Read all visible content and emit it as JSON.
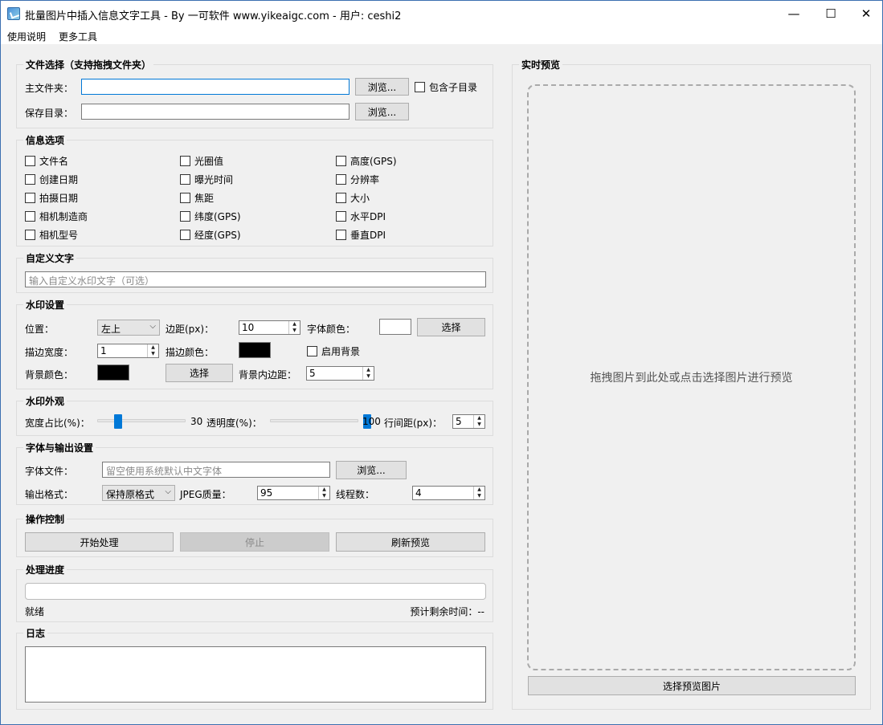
{
  "window": {
    "title": "批量图片中插入信息文字工具 - By 一可软件 www.yikeaigc.com - 用户: ceshi2",
    "minimize_glyph": "—",
    "maximize_glyph": "☐",
    "close_glyph": "✕"
  },
  "menu": [
    "使用说明",
    "更多工具"
  ],
  "file_select": {
    "title": "文件选择（支持拖拽文件夹）",
    "main_folder_label": "主文件夹：",
    "main_folder_value": "",
    "browse_label": "浏览...",
    "include_subdirs_label": "包含子目录",
    "save_dir_label": "保存目录：",
    "save_dir_value": "",
    "browse2_label": "浏览..."
  },
  "info_options": {
    "title": "信息选项",
    "items": [
      "文件名",
      "光圈值",
      "高度(GPS)",
      "创建日期",
      "曝光时间",
      "分辨率",
      "拍摄日期",
      "焦距",
      "大小",
      "相机制造商",
      "纬度(GPS)",
      "水平DPI",
      "相机型号",
      "经度(GPS)",
      "垂直DPI"
    ]
  },
  "custom_text": {
    "title": "自定义文字",
    "placeholder": "输入自定义水印文字（可选）"
  },
  "watermark": {
    "title": "水印设置",
    "position_label": "位置：",
    "position_value": "左上",
    "margin_label": "边距(px)：",
    "margin_value": "10",
    "font_color_label": "字体颜色：",
    "font_color": "#ffffff",
    "choose_label": "选择",
    "stroke_width_label": "描边宽度：",
    "stroke_width_value": "1",
    "stroke_color_label": "描边颜色：",
    "stroke_color": "#000000",
    "enable_bg_label": "启用背景",
    "bg_color_label": "背景颜色：",
    "bg_color": "#000000",
    "choose2_label": "选择",
    "bg_padding_label": "背景内边距：",
    "bg_padding_value": "5"
  },
  "appearance": {
    "title": "水印外观",
    "width_ratio_label": "宽度占比(%)：",
    "width_ratio_value": "30",
    "width_ratio_level": 30,
    "opacity_label": "透明度(%)：",
    "opacity_value": "100",
    "opacity_level": 100,
    "line_spacing_label": "行间距(px)：",
    "line_spacing_value": "5"
  },
  "font_output": {
    "title": "字体与输出设置",
    "font_file_label": "字体文件：",
    "font_file_placeholder": "留空使用系统默认中文字体",
    "browse_label": "浏览...",
    "output_format_label": "输出格式：",
    "output_format_value": "保持原格式",
    "jpeg_quality_label": "JPEG质量：",
    "jpeg_quality_value": "95",
    "threads_label": "线程数：",
    "threads_value": "4"
  },
  "controls": {
    "title": "操作控制",
    "start_label": "开始处理",
    "stop_label": "停止",
    "refresh_label": "刷新预览"
  },
  "progress": {
    "title": "处理进度",
    "value": 0,
    "status": "就绪",
    "remaining_label": "预计剩余时间：--"
  },
  "log": {
    "title": "日志"
  },
  "preview": {
    "title": "实时预览",
    "hint": "拖拽图片到此处或点击选择图片进行预览",
    "select_button": "选择预览图片"
  }
}
